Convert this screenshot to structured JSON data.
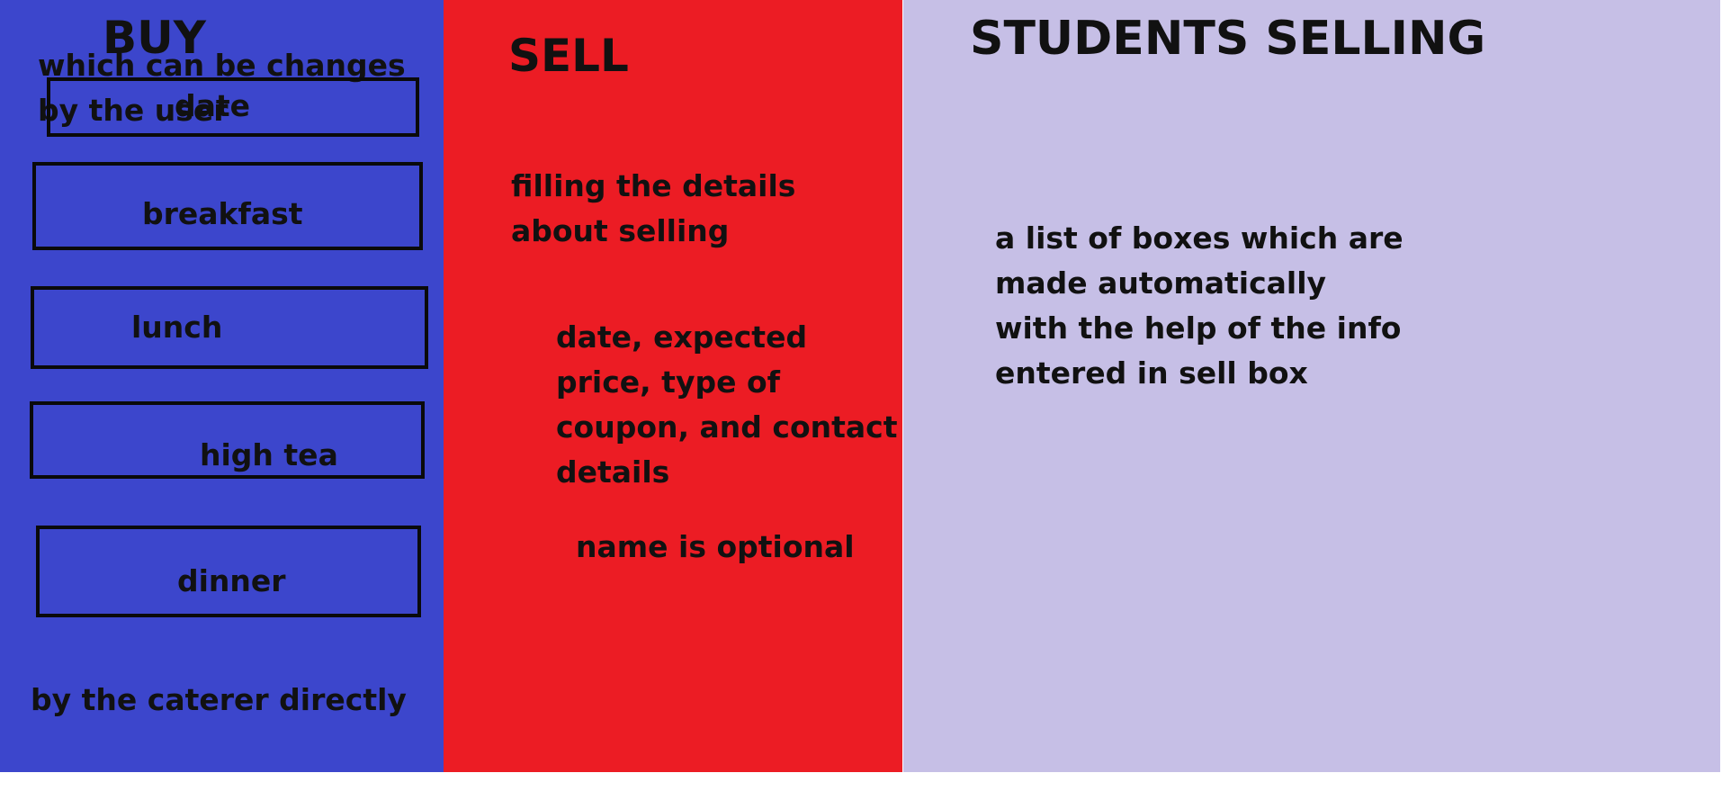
{
  "buy": {
    "title": "BUY",
    "user_note": "which can be changes by the user",
    "boxes": {
      "date": "date",
      "breakfast": "breakfast",
      "lunch": "lunch",
      "high_tea": "high tea",
      "dinner": "dinner"
    },
    "caterer_note": "by the caterer directly",
    "color": "#3c46cc"
  },
  "sell": {
    "title": "SELL",
    "details_intro": "filling the details about selling",
    "details_fields": "date, expected price, type of coupon, and contact details",
    "name_note": "name is optional",
    "color": "#ec1c24"
  },
  "students_selling": {
    "title": "STUDENTS SELLING",
    "description": "a list of boxes which are made automatically with the help of the info entered in sell box",
    "color": "#c6bfe6"
  }
}
